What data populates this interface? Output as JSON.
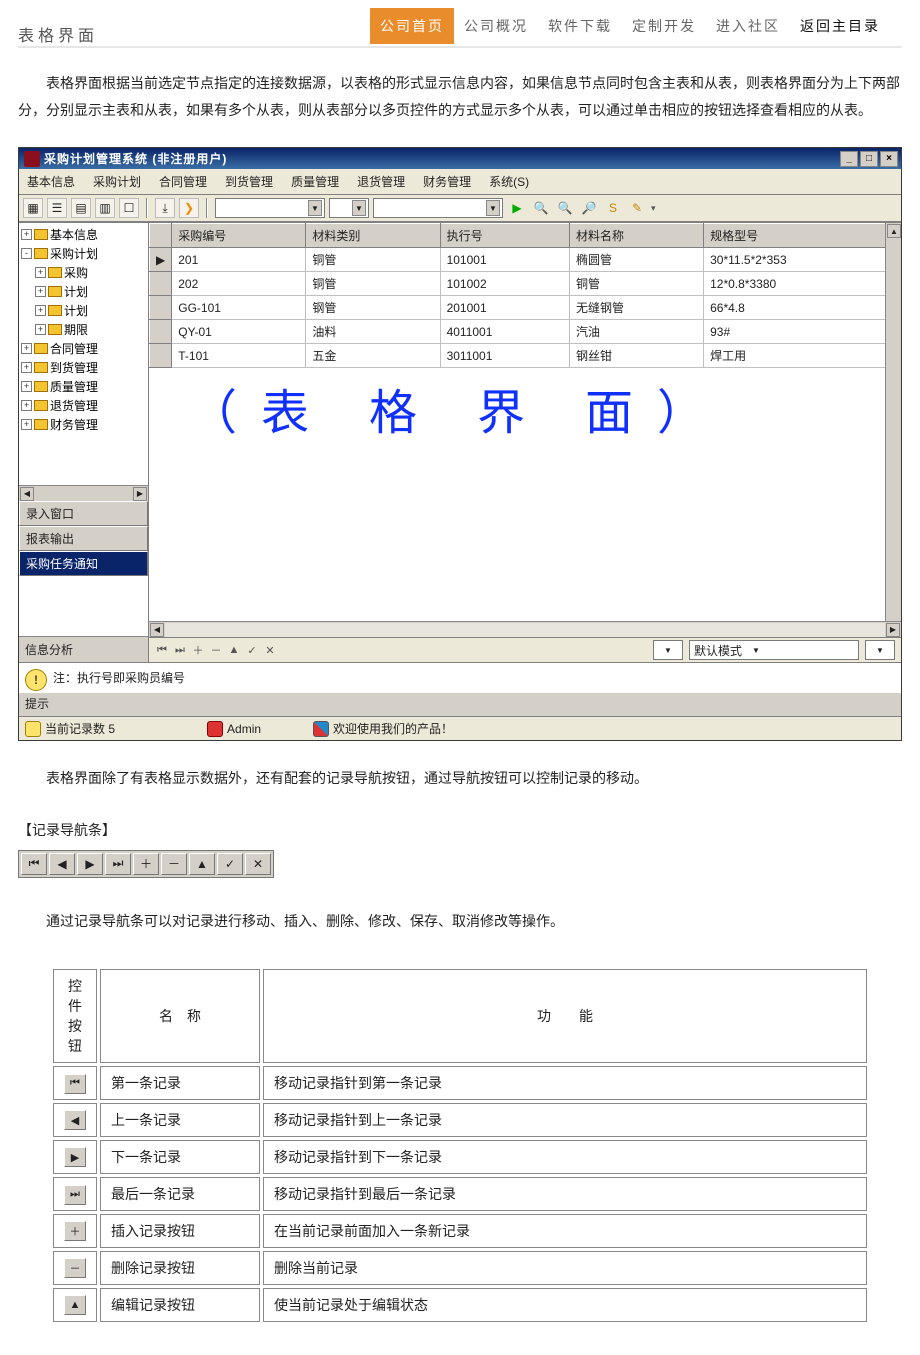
{
  "nav": {
    "items": [
      "公司首页",
      "公司概况",
      "软件下载",
      "定制开发",
      "进入社区",
      "返回主目录"
    ],
    "active_index": 0,
    "return_index": 5
  },
  "page_title": "表格界面",
  "intro_paragraph": "表格界面根据当前选定节点指定的连接数据源，以表格的形式显示信息内容，如果信息节点同时包含主表和从表，则表格界面分为上下两部分，分别显示主表和从表，如果有多个从表，则从表部分以多页控件的方式显示多个从表，可以通过单击相应的按钮选择查看相应的从表。",
  "app": {
    "title": "采购计划管理系统 (非注册用户)",
    "window_controls": {
      "minimize": "_",
      "maximize": "□",
      "close": "×"
    },
    "menubar": [
      "基本信息",
      "采购计划",
      "合同管理",
      "到货管理",
      "质量管理",
      "退货管理",
      "财务管理",
      "系统(S)"
    ],
    "tree": {
      "items": [
        {
          "indent": 0,
          "exp": "+",
          "label": "基本信息"
        },
        {
          "indent": 0,
          "exp": "-",
          "label": "采购计划"
        },
        {
          "indent": 1,
          "exp": "+",
          "label": "采购"
        },
        {
          "indent": 1,
          "exp": "+",
          "label": "计划"
        },
        {
          "indent": 1,
          "exp": "+",
          "label": "计划"
        },
        {
          "indent": 1,
          "exp": "+",
          "label": "期限"
        },
        {
          "indent": 0,
          "exp": "+",
          "label": "合同管理"
        },
        {
          "indent": 0,
          "exp": "+",
          "label": "到货管理"
        },
        {
          "indent": 0,
          "exp": "+",
          "label": "质量管理"
        },
        {
          "indent": 0,
          "exp": "+",
          "label": "退货管理"
        },
        {
          "indent": 0,
          "exp": "+",
          "label": "财务管理"
        }
      ],
      "buttons": [
        "录入窗口",
        "报表输出",
        "采购任务通知"
      ],
      "selected_button_index": 2,
      "footer": "信息分析"
    },
    "grid": {
      "columns": [
        "采购编号",
        "材料类别",
        "执行号",
        "材料名称",
        "规格型号"
      ],
      "rows": [
        {
          "c0": "201",
          "c1": "铜管",
          "c2": "101001",
          "c3": "椭圆管",
          "c4": "30*11.5*2*353"
        },
        {
          "c0": "202",
          "c1": "铜管",
          "c2": "101002",
          "c3": "铜管",
          "c4": "12*0.8*3380"
        },
        {
          "c0": "GG-101",
          "c1": "钢管",
          "c2": "201001",
          "c3": "无缝钢管",
          "c4": "66*4.8"
        },
        {
          "c0": "QY-01",
          "c1": "油料",
          "c2": "4011001",
          "c3": "汽油",
          "c4": "93#"
        },
        {
          "c0": "T-101",
          "c1": "五金",
          "c2": "3011001",
          "c3": "钢丝钳",
          "c4": "焊工用"
        }
      ],
      "watermark": "（表 格 界 面）",
      "mode_label": "默认模式"
    },
    "hint": {
      "label": "提示",
      "text": "注：执行号即采购员编号"
    },
    "status": {
      "record_count_label": "当前记录数 5",
      "user": "Admin",
      "welcome": "欢迎使用我们的产品！"
    }
  },
  "post_paragraph": "表格界面除了有表格显示数据外，还有配套的记录导航按钮，通过导航按钮可以控制记录的移动。",
  "recnav_heading": "【记录导航条】",
  "recnav_desc": "通过记录导航条可以对记录进行移动、插入、删除、修改、保存、取消修改等操作。",
  "recnav_glyphs": [
    "⏮",
    "◀",
    "▶",
    "⏭",
    "＋",
    "－",
    "▲",
    "✓",
    "✕"
  ],
  "desc_table": {
    "headers": [
      "控件按钮",
      "名　称",
      "功　　能"
    ],
    "rows": [
      {
        "glyph": "⏮",
        "name": "第一条记录",
        "func": "移动记录指针到第一条记录"
      },
      {
        "glyph": "◀",
        "name": "上一条记录",
        "func": "移动记录指针到上一条记录"
      },
      {
        "glyph": "▶",
        "name": "下一条记录",
        "func": "移动记录指针到下一条记录"
      },
      {
        "glyph": "⏭",
        "name": "最后一条记录",
        "func": "移动记录指针到最后一条记录"
      },
      {
        "glyph": "＋",
        "name": "插入记录按钮",
        "func": "在当前记录前面加入一条新记录"
      },
      {
        "glyph": "－",
        "name": "删除记录按钮",
        "func": "删除当前记录"
      },
      {
        "glyph": "▲",
        "name": "编辑记录按钮",
        "func": "使当前记录处于编辑状态"
      }
    ]
  }
}
